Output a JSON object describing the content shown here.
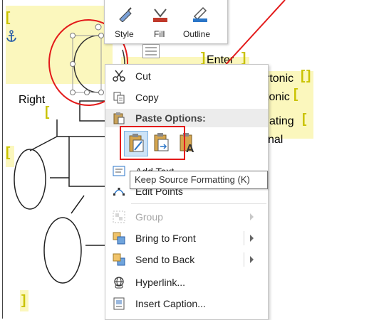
{
  "document": {
    "text_enter": "Enter",
    "text_right": "Right",
    "text_tonic1": "rtonic",
    "text_tonic2": "tonic",
    "text_ating": "ating",
    "text_nal": "nal"
  },
  "mini_toolbar": {
    "style_label": "Style",
    "fill_label": "Fill",
    "outline_label": "Outline"
  },
  "context_menu": {
    "cut": "Cut",
    "copy": "Copy",
    "paste_options": "Paste Options:",
    "add_text": "Add Text",
    "edit_points": "Edit Points",
    "group": "Group",
    "bring_to_front": "Bring to Front",
    "send_to_back": "Send to Back",
    "hyperlink": "Hyperlink...",
    "insert_caption": "Insert Caption..."
  },
  "tooltip": {
    "text": "Keep Source Formatting (K)"
  },
  "colors": {
    "annotation_red": "#e31a1a",
    "highlight": "#fbf7bd",
    "accent_blue": "#2b76c8"
  }
}
